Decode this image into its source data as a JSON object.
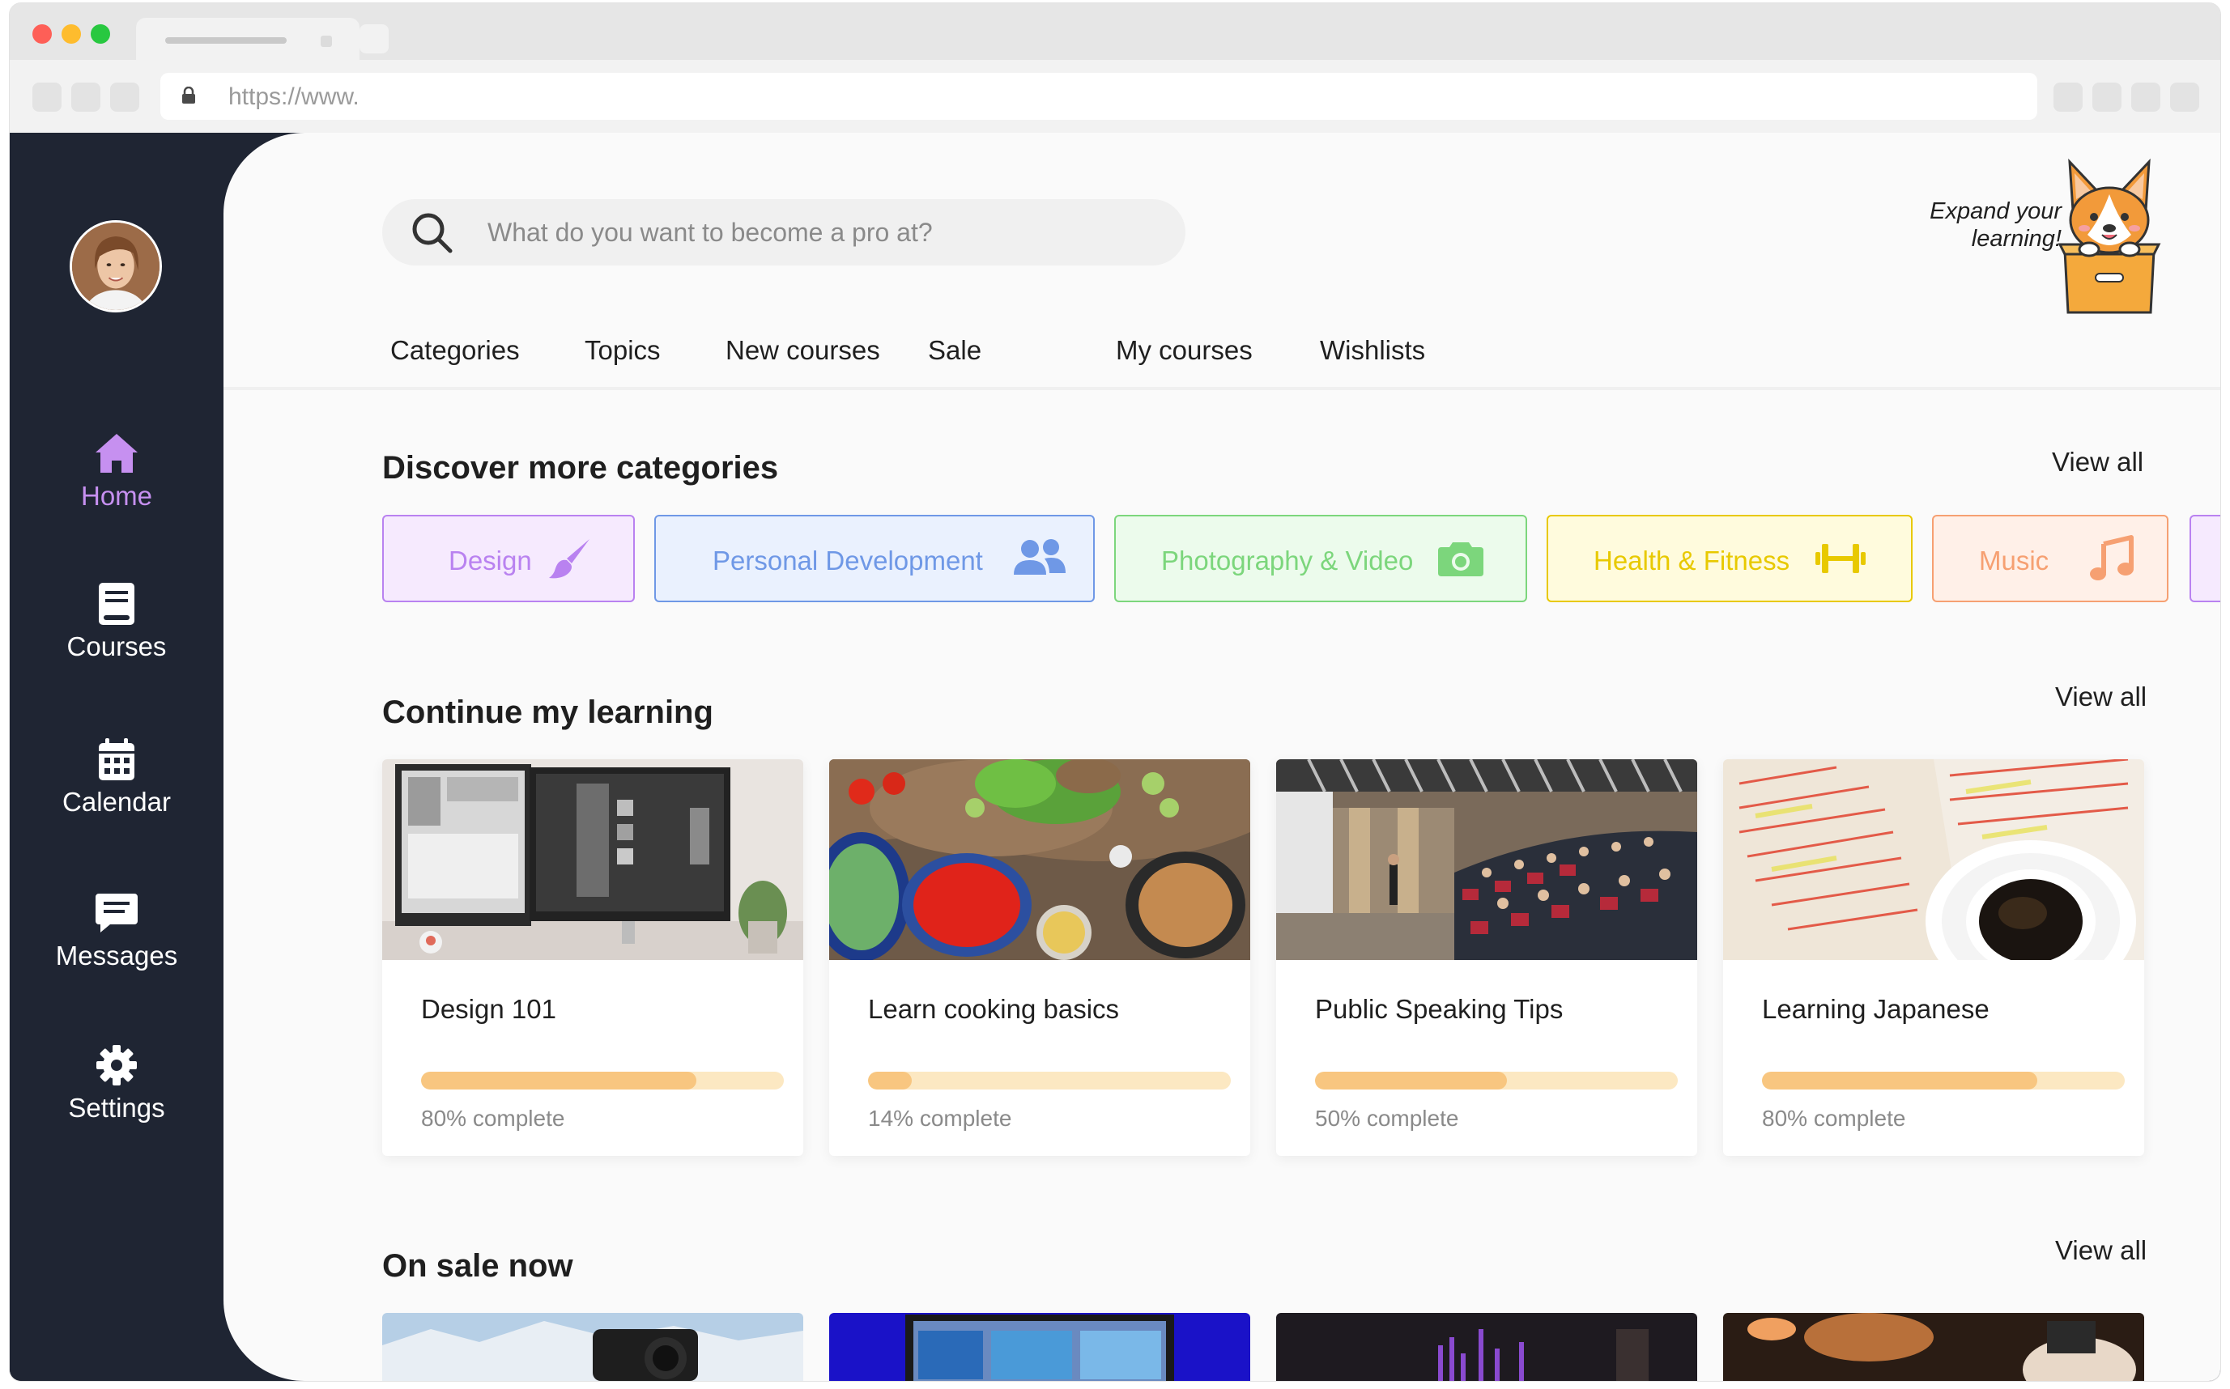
{
  "browser": {
    "url": "https://www."
  },
  "sidebar": {
    "items": [
      {
        "label": "Home",
        "icon": "home-icon",
        "active": true
      },
      {
        "label": "Courses",
        "icon": "book-icon",
        "active": false
      },
      {
        "label": "Calendar",
        "icon": "calendar-icon",
        "active": false
      },
      {
        "label": "Messages",
        "icon": "message-icon",
        "active": false
      },
      {
        "label": "Settings",
        "icon": "gear-icon",
        "active": false
      }
    ]
  },
  "header": {
    "search_placeholder": "What do you want to become a pro at?",
    "promo_line1": "Expand your",
    "promo_line2": "learning!",
    "nav": [
      "Categories",
      "Topics",
      "New courses",
      "Sale",
      "My courses",
      "Wishlists"
    ]
  },
  "categories": {
    "title": "Discover more categories",
    "view_all": "View all",
    "items": [
      {
        "label": "Design",
        "icon": "paintbrush-icon",
        "color": "#b982f0",
        "bg": "#f6eafe"
      },
      {
        "label": "Personal Development",
        "icon": "people-icon",
        "color": "#6f98e6",
        "bg": "#eaf1fe"
      },
      {
        "label": "Photography & Video",
        "icon": "camera-icon",
        "color": "#7cd67c",
        "bg": "#ecfbec"
      },
      {
        "label": "Health & Fitness",
        "icon": "dumbbell-icon",
        "color": "#e8c900",
        "bg": "#fffbdd"
      },
      {
        "label": "Music",
        "icon": "music-note-icon",
        "color": "#f6a072",
        "bg": "#fff0e8"
      }
    ]
  },
  "learning": {
    "title": "Continue my learning",
    "view_all": "View all",
    "courses": [
      {
        "title": "Design 101",
        "progress": 0.76,
        "progress_text": "80% complete"
      },
      {
        "title": "Learn cooking basics",
        "progress": 0.12,
        "progress_text": "14% complete"
      },
      {
        "title": "Public Speaking Tips",
        "progress": 0.53,
        "progress_text": "50% complete"
      },
      {
        "title": "Learning Japanese",
        "progress": 0.76,
        "progress_text": "80% complete"
      }
    ]
  },
  "sale": {
    "title": "On sale now",
    "view_all": "View all"
  },
  "colors": {
    "sidebar_bg": "#1f2533",
    "accent": "#c690f0",
    "progress_fill": "#f8c680",
    "progress_track": "#fce8c2"
  }
}
